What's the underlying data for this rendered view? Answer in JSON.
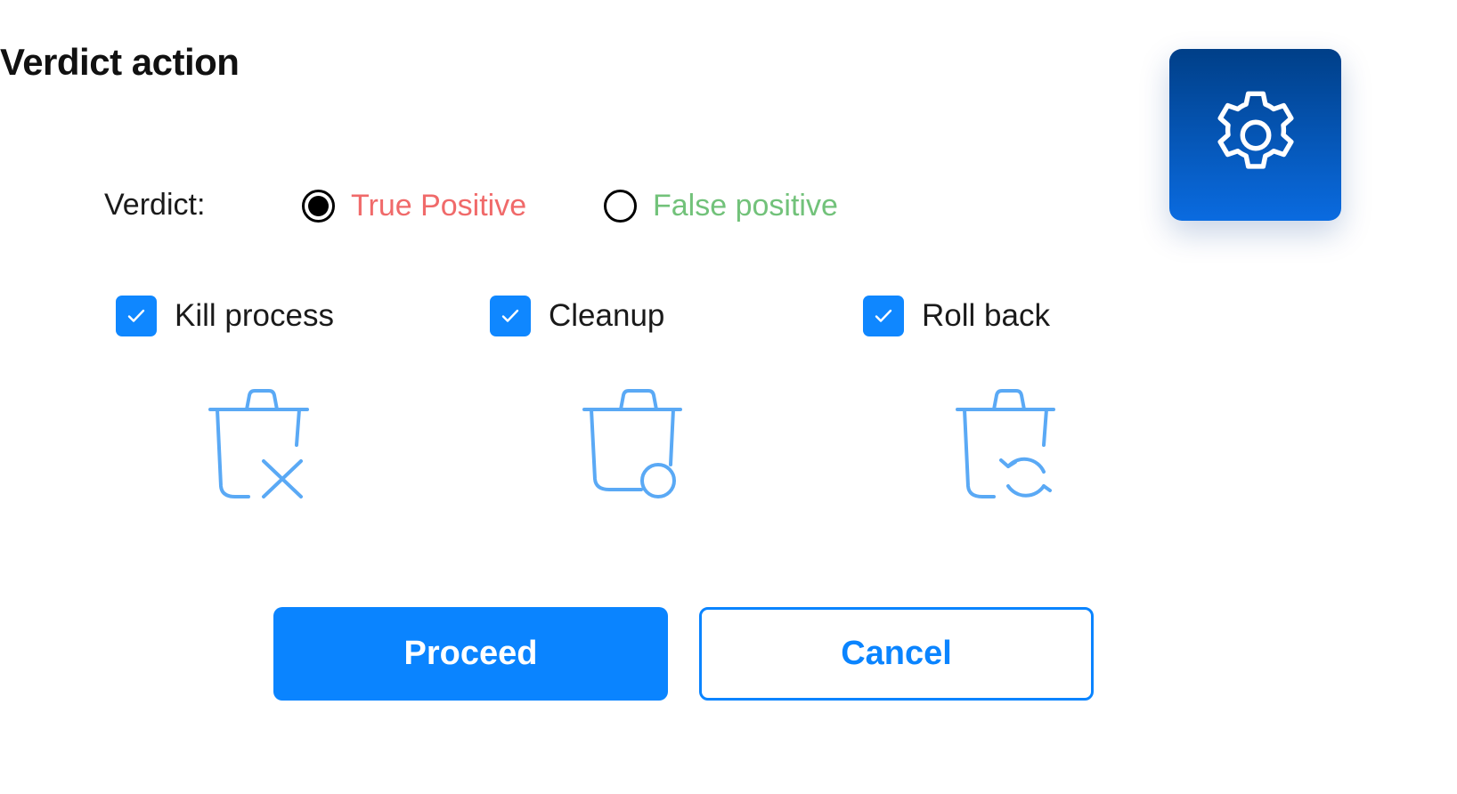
{
  "header": {
    "title": "Verdict action"
  },
  "settings": {
    "icon": "gear-icon",
    "tile_color_top": "#003f88",
    "tile_color_bottom": "#0a6be0"
  },
  "verdict": {
    "label": "Verdict:",
    "options": [
      {
        "label": "True Positive",
        "selected": true,
        "color": "#f06a6a"
      },
      {
        "label": "False positive",
        "selected": false,
        "color": "#72c27a"
      }
    ]
  },
  "actions": [
    {
      "label": "Kill process",
      "checked": true,
      "icon": "trash-kill-icon"
    },
    {
      "label": "Cleanup",
      "checked": true,
      "icon": "trash-cleanup-icon"
    },
    {
      "label": "Roll back",
      "checked": true,
      "icon": "trash-rollback-icon"
    }
  ],
  "buttons": {
    "proceed": "Proceed",
    "cancel": "Cancel"
  },
  "colors": {
    "accent": "#0a84ff",
    "icon_stroke": "#5aa9f5"
  }
}
